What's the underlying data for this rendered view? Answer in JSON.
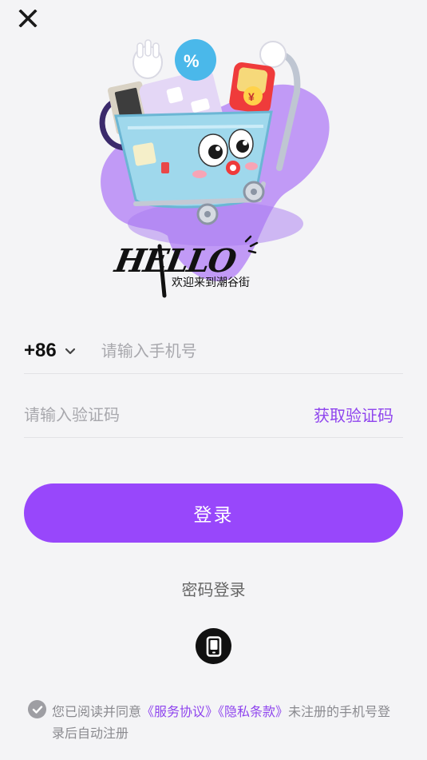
{
  "header": {
    "close_icon": "close-icon"
  },
  "hero": {
    "illustration": "shopping-cart-mascot",
    "logo_text": "HELLO",
    "welcome_text": "欢迎来到潮谷街"
  },
  "phone": {
    "country_code": "+86",
    "placeholder": "请输入手机号"
  },
  "verification": {
    "placeholder": "请输入验证码",
    "get_code_label": "获取验证码"
  },
  "login_button": "登录",
  "password_login": "密码登录",
  "device_icon": "phone-icon",
  "agreement": {
    "prefix": "您已阅读并同意",
    "service_terms": "《服务协议》",
    "privacy_terms": "《隐私条款》",
    "suffix": "未注册的手机号登录后自动注册"
  },
  "colors": {
    "accent": "#9847fb",
    "link": "#8f45ee",
    "background": "#f4f4f6"
  }
}
